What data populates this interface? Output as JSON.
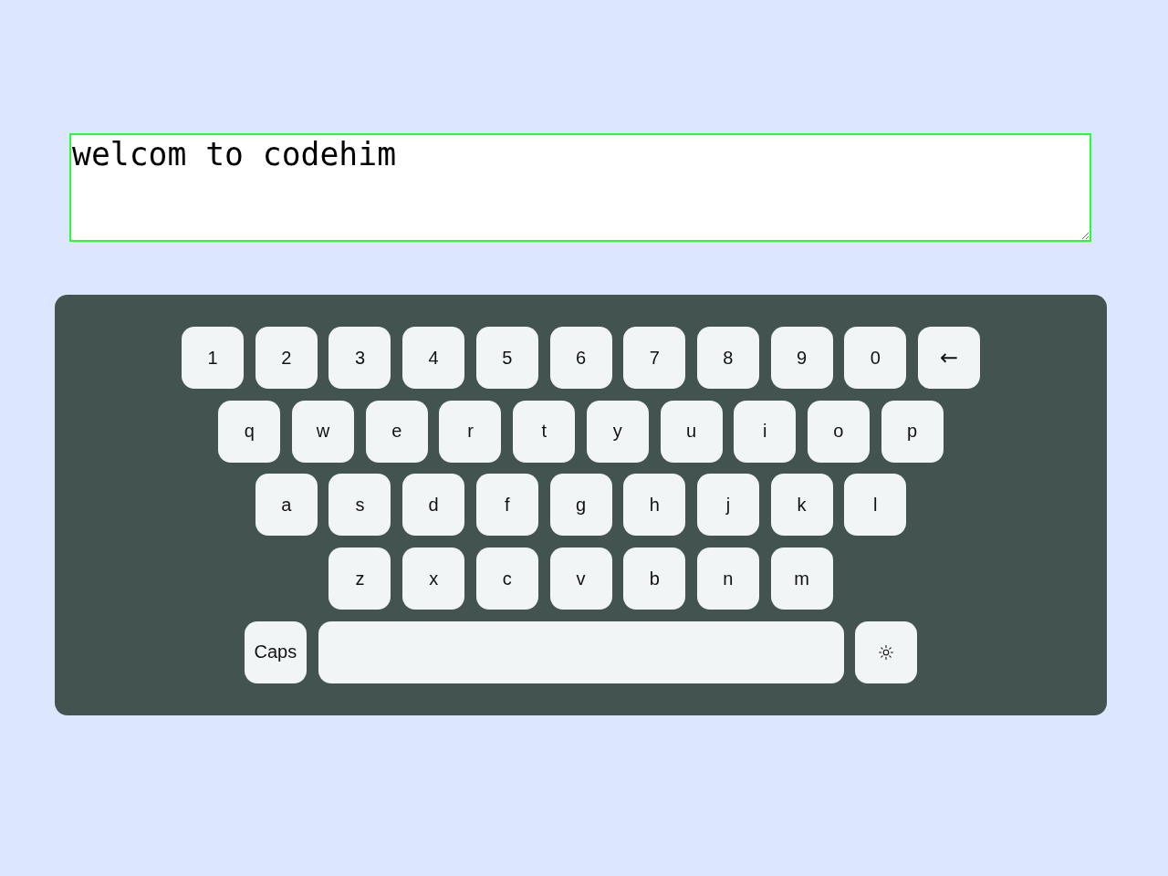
{
  "text_area": {
    "value": "welcom to codehim"
  },
  "keyboard": {
    "rows": [
      {
        "keys": [
          {
            "kind": "char",
            "label": "1"
          },
          {
            "kind": "char",
            "label": "2"
          },
          {
            "kind": "char",
            "label": "3"
          },
          {
            "kind": "char",
            "label": "4"
          },
          {
            "kind": "char",
            "label": "5"
          },
          {
            "kind": "char",
            "label": "6"
          },
          {
            "kind": "char",
            "label": "7"
          },
          {
            "kind": "char",
            "label": "8"
          },
          {
            "kind": "char",
            "label": "9"
          },
          {
            "kind": "char",
            "label": "0"
          },
          {
            "kind": "backspace",
            "label": "←"
          }
        ]
      },
      {
        "keys": [
          {
            "kind": "char",
            "label": "q"
          },
          {
            "kind": "char",
            "label": "w"
          },
          {
            "kind": "char",
            "label": "e"
          },
          {
            "kind": "char",
            "label": "r"
          },
          {
            "kind": "char",
            "label": "t"
          },
          {
            "kind": "char",
            "label": "y"
          },
          {
            "kind": "char",
            "label": "u"
          },
          {
            "kind": "char",
            "label": "i"
          },
          {
            "kind": "char",
            "label": "o"
          },
          {
            "kind": "char",
            "label": "p"
          }
        ]
      },
      {
        "keys": [
          {
            "kind": "char",
            "label": "a"
          },
          {
            "kind": "char",
            "label": "s"
          },
          {
            "kind": "char",
            "label": "d"
          },
          {
            "kind": "char",
            "label": "f"
          },
          {
            "kind": "char",
            "label": "g"
          },
          {
            "kind": "char",
            "label": "h"
          },
          {
            "kind": "char",
            "label": "j"
          },
          {
            "kind": "char",
            "label": "k"
          },
          {
            "kind": "char",
            "label": "l"
          }
        ]
      },
      {
        "keys": [
          {
            "kind": "char",
            "label": "z"
          },
          {
            "kind": "char",
            "label": "x"
          },
          {
            "kind": "char",
            "label": "c"
          },
          {
            "kind": "char",
            "label": "v"
          },
          {
            "kind": "char",
            "label": "b"
          },
          {
            "kind": "char",
            "label": "n"
          },
          {
            "kind": "char",
            "label": "m"
          }
        ]
      },
      {
        "keys": [
          {
            "kind": "caps",
            "label": "Caps"
          },
          {
            "kind": "space"
          },
          {
            "kind": "theme"
          }
        ]
      }
    ]
  }
}
